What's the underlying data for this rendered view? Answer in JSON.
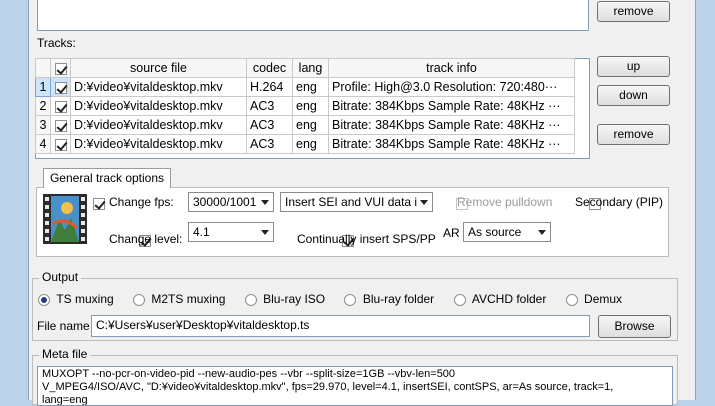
{
  "top": {
    "remove_label": "remove"
  },
  "tracks": {
    "label": "Tracks:",
    "headers": [
      "source file",
      "codec",
      "lang",
      "track info"
    ],
    "rows": [
      {
        "num": "1",
        "file": "D:¥video¥vitaldesktop.mkv",
        "codec": "H.264",
        "lang": "eng",
        "info": "Profile: High@3.0  Resolution: 720:480···",
        "selected": true
      },
      {
        "num": "2",
        "file": "D:¥video¥vitaldesktop.mkv",
        "codec": "AC3",
        "lang": "eng",
        "info": "Bitrate: 384Kbps Sample Rate: 48KHz ···",
        "selected": false
      },
      {
        "num": "3",
        "file": "D:¥video¥vitaldesktop.mkv",
        "codec": "AC3",
        "lang": "eng",
        "info": "Bitrate: 384Kbps Sample Rate: 48KHz ···",
        "selected": false
      },
      {
        "num": "4",
        "file": "D:¥video¥vitaldesktop.mkv",
        "codec": "AC3",
        "lang": "eng",
        "info": "Bitrate: 384Kbps Sample Rate: 48KHz ···",
        "selected": false
      }
    ],
    "up_label": "up",
    "down_label": "down",
    "remove_label": "remove"
  },
  "options": {
    "tab_label": "General track options",
    "change_fps_label": "Change fps:",
    "fps_value": "30000/1001",
    "sei_value": "Insert SEI and VUI data i",
    "remove_pulldown_label": "Remove pulldown",
    "secondary_label": "Secondary (PIP)",
    "change_level_label": "Change level:",
    "level_value": "4.1",
    "continually_label": "Continually insert SPS/PP",
    "ar_label": "AR",
    "ar_value": "As source"
  },
  "output": {
    "title": "Output",
    "modes": [
      "TS muxing",
      "M2TS muxing",
      "Blu-ray ISO",
      "Blu-ray folder",
      "AVCHD folder",
      "Demux"
    ],
    "selected_mode": "TS muxing",
    "file_name_label": "File name",
    "file_name_value": "C:¥Users¥user¥Desktop¥vitaldesktop.ts",
    "browse_label": "Browse"
  },
  "meta": {
    "title": "Meta file",
    "line1": "MUXOPT --no-pcr-on-video-pid --new-audio-pes --vbr  --split-size=1GB --vbv-len=500",
    "line2": "V_MPEG4/ISO/AVC, \"D:¥video¥vitaldesktop.mkv\", fps=29.970, level=4.1, insertSEI, contSPS, ar=As source, track=1,",
    "line3": "lang=eng"
  },
  "colors": {
    "background": "#bcd1ea",
    "window": "#f0f0f0",
    "selection": "#cde4fa",
    "radio_dot": "#1f3f7a"
  }
}
